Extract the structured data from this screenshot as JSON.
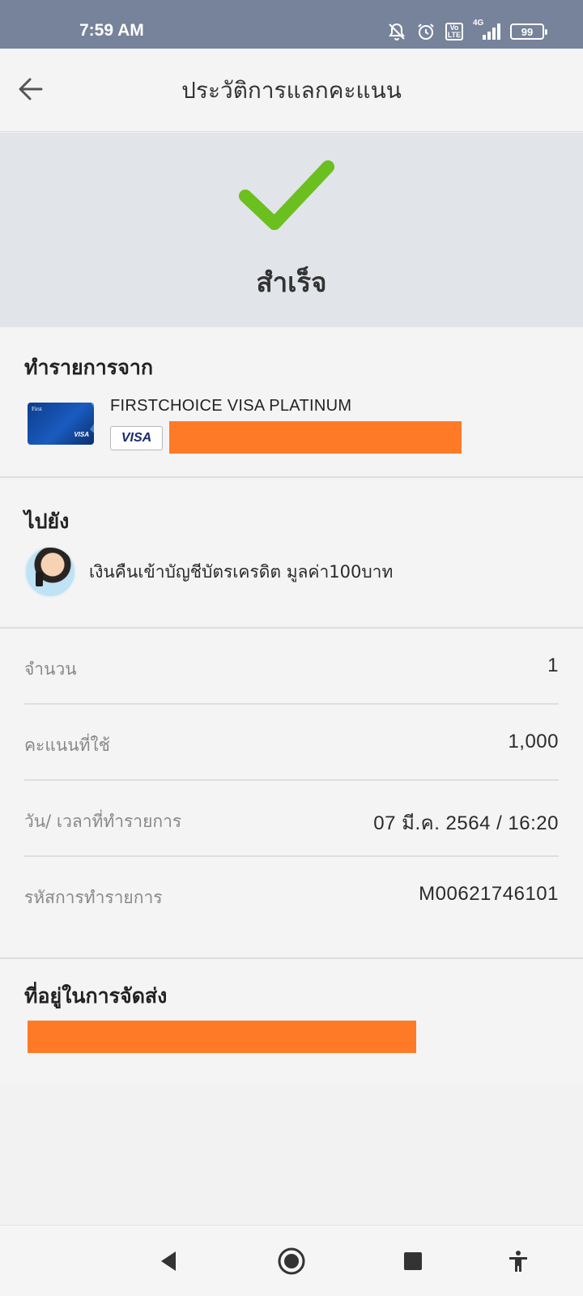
{
  "status_bar": {
    "time": "7:59 AM",
    "icons": [
      "alarm-off-icon",
      "alarm-icon",
      "volte-icon",
      "signal-4g-icon",
      "battery-icon"
    ],
    "volte_top": "Vo",
    "volte_bottom": "LTE",
    "network": "4G",
    "battery": "99"
  },
  "header": {
    "title": "ประวัติการแลกคะแนน",
    "back_icon": "arrow-left-icon"
  },
  "result": {
    "status_text": "สำเร็จ",
    "icon": "check-icon",
    "color": "#6bbf1f"
  },
  "from": {
    "heading": "ทำรายการจาก",
    "card_name": "FIRSTCHOICE VISA PLATINUM",
    "card_brand_badge": "VISA",
    "card_art_brand": "First",
    "card_art_network": "VISA"
  },
  "to": {
    "heading": "ไปยัง",
    "reward_name": "เงินคืนเข้าบัญชีบัตรเครดิต มูลค่า100บาท"
  },
  "details": [
    {
      "label": "จำนวน",
      "value": "1"
    },
    {
      "label": "คะแนนที่ใช้",
      "value": "1,000"
    },
    {
      "label": "วัน/ เวลาที่ทำรายการ",
      "value": "07 มี.ค. 2564 / 16:20"
    },
    {
      "label": "รหัสการทำรายการ",
      "value": "M00621746101"
    }
  ],
  "shipping": {
    "heading": "ที่อยู่ในการจัดส่ง"
  },
  "colors": {
    "redaction": "#ff7a26",
    "status_bar": "#77839a",
    "success_band": "#e1e4e8"
  },
  "nav_bar": {
    "icons": [
      "back-triangle-icon",
      "home-circle-icon",
      "recents-square-icon",
      "accessibility-icon"
    ]
  }
}
